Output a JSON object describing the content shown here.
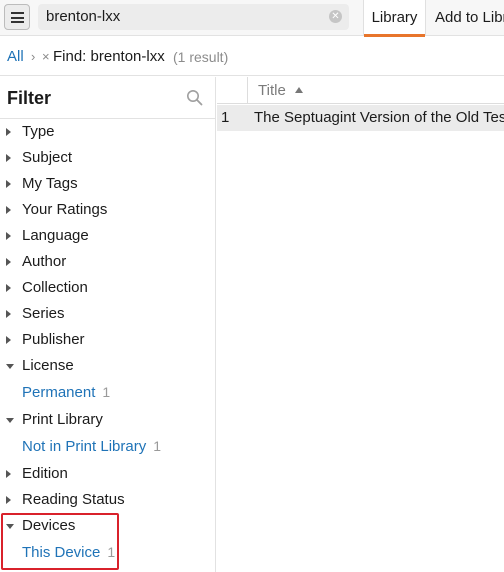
{
  "toolbar": {
    "search_value": "brenton-lxx",
    "tabs": [
      {
        "label": "Library",
        "active": true
      },
      {
        "label": "Add to Libr"
      }
    ]
  },
  "breadcrumb": {
    "all": "All",
    "separator": "›",
    "remove": "×",
    "find": "Find: brenton-lxx",
    "count": "(1 result)"
  },
  "sidebar": {
    "title": "Filter",
    "items": [
      {
        "label": "Type",
        "expanded": false
      },
      {
        "label": "Subject",
        "expanded": false
      },
      {
        "label": "My Tags",
        "expanded": false
      },
      {
        "label": "Your Ratings",
        "expanded": false
      },
      {
        "label": "Language",
        "expanded": false
      },
      {
        "label": "Author",
        "expanded": false
      },
      {
        "label": "Collection",
        "expanded": false
      },
      {
        "label": "Series",
        "expanded": false
      },
      {
        "label": "Publisher",
        "expanded": false
      },
      {
        "label": "License",
        "expanded": true,
        "children": [
          {
            "label": "Permanent",
            "count": "1"
          }
        ]
      },
      {
        "label": "Print Library",
        "expanded": true,
        "children": [
          {
            "label": "Not in Print Library",
            "count": "1"
          }
        ]
      },
      {
        "label": "Edition",
        "expanded": false
      },
      {
        "label": "Reading Status",
        "expanded": false
      },
      {
        "label": "Devices",
        "expanded": true,
        "children": [
          {
            "label": "This Device",
            "count": "1"
          }
        ]
      }
    ]
  },
  "table": {
    "columns": [
      "",
      "Title"
    ],
    "sort": "ascending",
    "rows": [
      {
        "num": "1",
        "title": "The Septuagint Version of the Old Testa"
      }
    ]
  },
  "colors": {
    "accent": "#e8752b",
    "link": "#1f73b7",
    "highlight_box": "#d9212b"
  }
}
